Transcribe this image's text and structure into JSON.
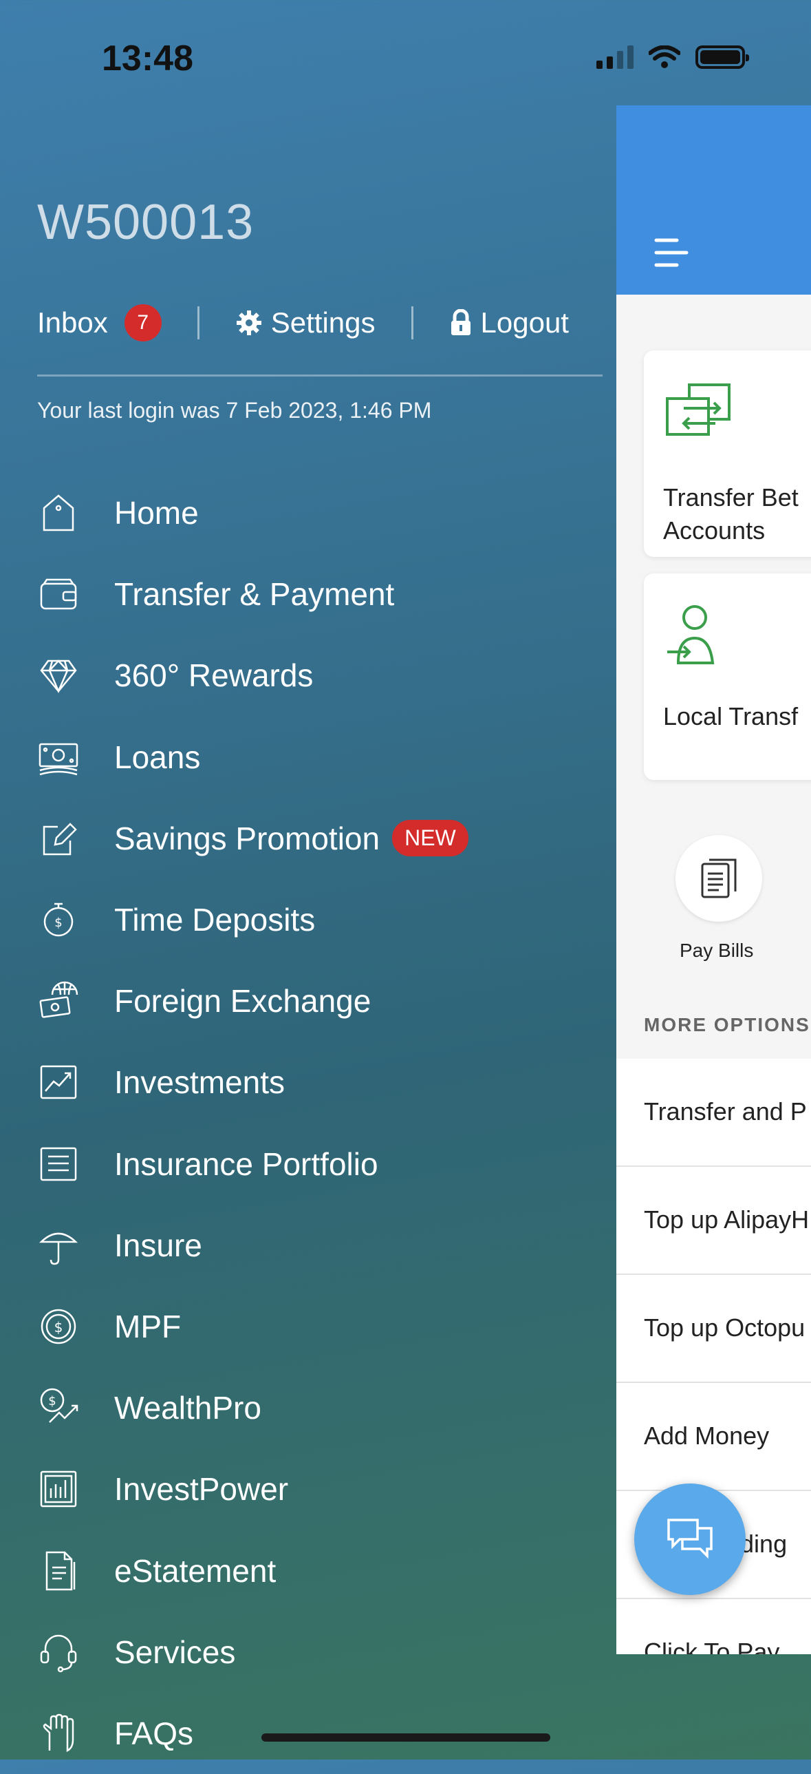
{
  "status_bar": {
    "time": "13:48"
  },
  "drawer": {
    "user_id": "W500013",
    "inbox_label": "Inbox",
    "inbox_count": "7",
    "settings_label": "Settings",
    "logout_label": "Logout",
    "last_login": "Your last login was 7 Feb 2023, 1:46 PM",
    "menu": [
      {
        "label": "Home",
        "icon": "home-icon"
      },
      {
        "label": "Transfer & Payment",
        "icon": "wallet-icon"
      },
      {
        "label": "360° Rewards",
        "icon": "diamond-icon"
      },
      {
        "label": "Loans",
        "icon": "banknote-icon"
      },
      {
        "label": "Savings Promotion",
        "icon": "edit-icon",
        "badge": "NEW"
      },
      {
        "label": "Time Deposits",
        "icon": "stopwatch-dollar-icon"
      },
      {
        "label": "Foreign Exchange",
        "icon": "globe-money-icon"
      },
      {
        "label": "Investments",
        "icon": "chart-icon"
      },
      {
        "label": "Insurance Portfolio",
        "icon": "list-icon"
      },
      {
        "label": "Insure",
        "icon": "umbrella-icon"
      },
      {
        "label": "MPF",
        "icon": "dollar-coin-icon"
      },
      {
        "label": "WealthPro",
        "icon": "dollar-trend-icon"
      },
      {
        "label": "InvestPower",
        "icon": "bar-chart-icon"
      },
      {
        "label": "eStatement",
        "icon": "document-icon"
      },
      {
        "label": "Services",
        "icon": "headset-icon"
      },
      {
        "label": "FAQs",
        "icon": "hand-icon"
      }
    ]
  },
  "panel": {
    "card_transfer_between": "Transfer Bet\nAccounts",
    "card_transfer_between_line1": "Transfer Bet",
    "card_transfer_between_line2": "Accounts",
    "card_local_transfer": "Local Transf",
    "pay_bills": "Pay Bills",
    "more_options_label": "MORE OPTIONS",
    "options": [
      "Transfer and P",
      "Top up AlipayH",
      "Top up Octopu",
      "Add Money",
      "nding",
      "Click To Pay"
    ]
  },
  "colors": {
    "header_blue": "#3f8edf",
    "badge_red": "#d42b2b",
    "icon_green": "#3a9e4a",
    "chat_blue": "#5aa9ea"
  }
}
